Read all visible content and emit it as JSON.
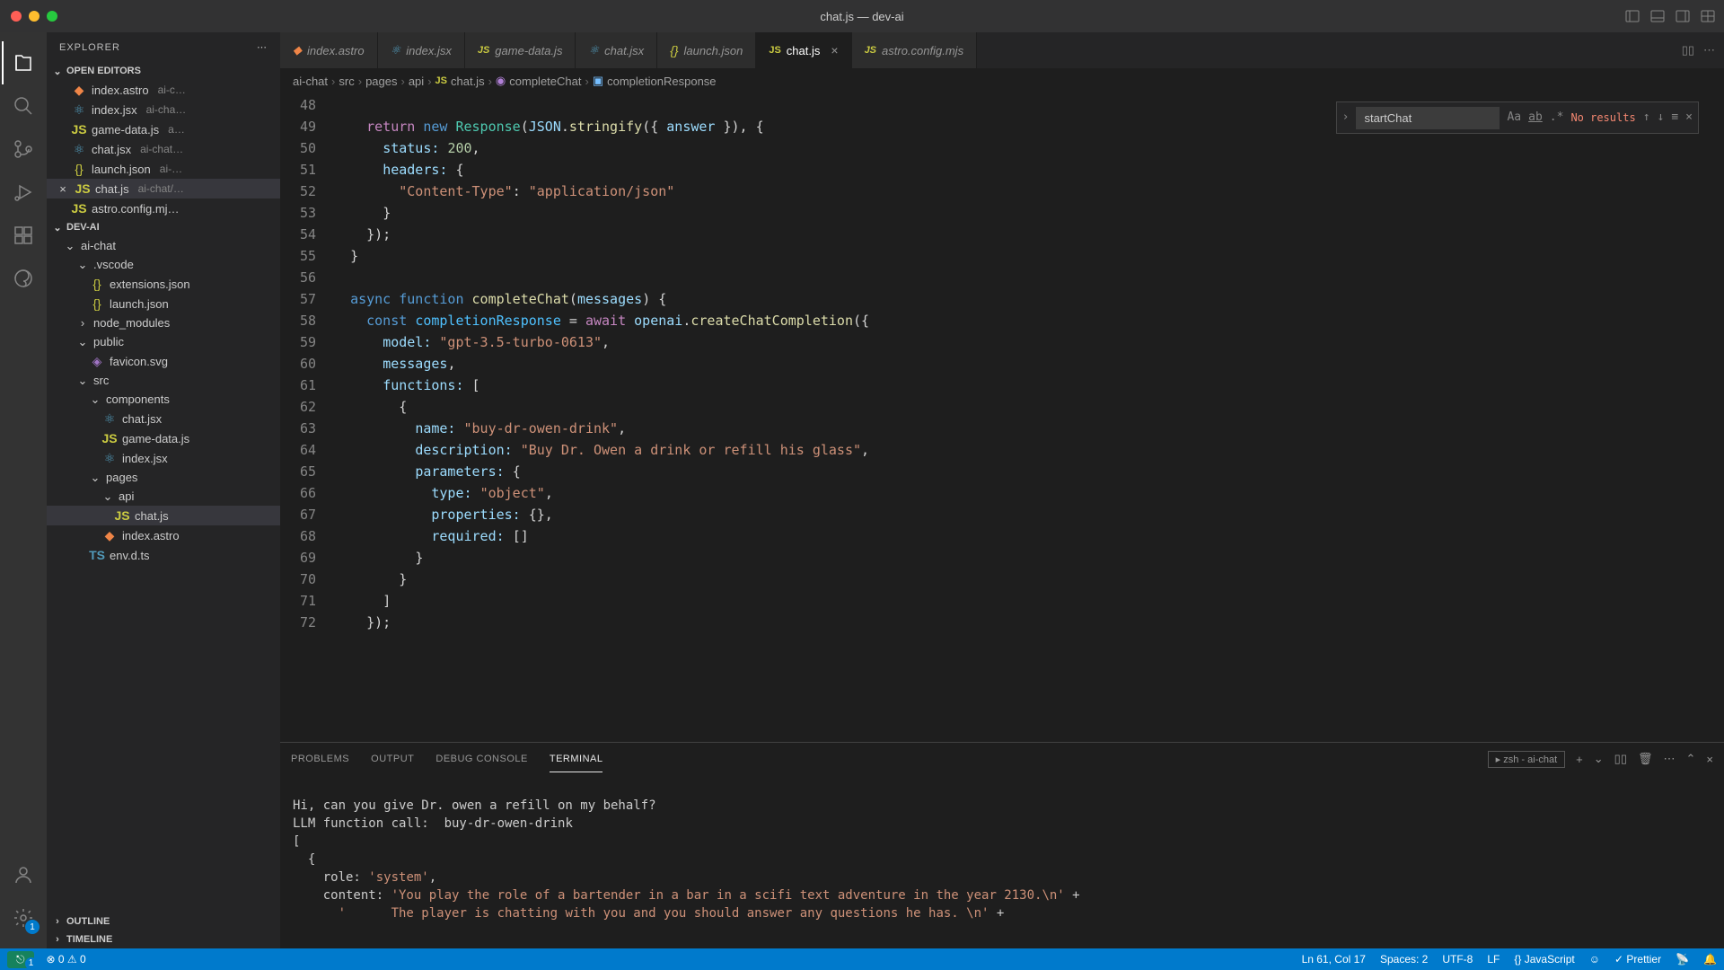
{
  "window": {
    "title": "chat.js — dev-ai"
  },
  "sidebar": {
    "header": "EXPLORER",
    "sections": {
      "open_editors": "OPEN EDITORS",
      "project": "DEV-AI",
      "outline": "OUTLINE",
      "timeline": "TIMELINE"
    },
    "open_editors": [
      {
        "name": "index.astro",
        "path": "ai-c…",
        "icon": "astro"
      },
      {
        "name": "index.jsx",
        "path": "ai-cha…",
        "icon": "jsx"
      },
      {
        "name": "game-data.js",
        "path": "a…",
        "icon": "js"
      },
      {
        "name": "chat.jsx",
        "path": "ai-chat…",
        "icon": "jsx"
      },
      {
        "name": "launch.json",
        "path": "ai-…",
        "icon": "json"
      },
      {
        "name": "chat.js",
        "path": "ai-chat/…",
        "icon": "js",
        "active": true
      },
      {
        "name": "astro.config.mj…",
        "path": "",
        "icon": "js"
      }
    ],
    "tree": {
      "root": "ai-chat",
      "vscode": ".vscode",
      "extensions": "extensions.json",
      "launch": "launch.json",
      "node_modules": "node_modules",
      "public": "public",
      "favicon": "favicon.svg",
      "src": "src",
      "components": "components",
      "chat_jsx": "chat.jsx",
      "game_data": "game-data.js",
      "index_jsx": "index.jsx",
      "pages": "pages",
      "api": "api",
      "chat_js": "chat.js",
      "index_astro": "index.astro",
      "env": "env.d.ts"
    }
  },
  "tabs": [
    {
      "label": "index.astro",
      "icon": "astro"
    },
    {
      "label": "index.jsx",
      "icon": "jsx"
    },
    {
      "label": "game-data.js",
      "icon": "js"
    },
    {
      "label": "chat.jsx",
      "icon": "jsx"
    },
    {
      "label": "launch.json",
      "icon": "json"
    },
    {
      "label": "chat.js",
      "icon": "js",
      "active": true
    },
    {
      "label": "astro.config.mjs",
      "icon": "js"
    }
  ],
  "breadcrumbs": [
    "ai-chat",
    "src",
    "pages",
    "api",
    "chat.js",
    "completeChat",
    "completionResponse"
  ],
  "find": {
    "value": "startChat",
    "results": "No results"
  },
  "code": {
    "lines": [
      48,
      49,
      50,
      51,
      52,
      53,
      54,
      55,
      56,
      57,
      58,
      59,
      60,
      61,
      62,
      63,
      64,
      65,
      66,
      67,
      68,
      69,
      70,
      71,
      72
    ],
    "l48": "",
    "l49_ret": "return",
    "l49_new": "new",
    "l49_resp": "Response",
    "l49_json": "JSON",
    "l49_strify": "stringify",
    "l49_ans": "answer",
    "l50_status": "status:",
    "l50_200": "200",
    "l51_headers": "headers:",
    "l52_ct": "\"Content-Type\"",
    "l52_val": "\"application/json\"",
    "l57_async": "async",
    "l57_fn": "function",
    "l57_name": "completeChat",
    "l57_param": "messages",
    "l58_const": "const",
    "l58_var": "completionResponse",
    "l58_await": "await",
    "l58_openai": "openai",
    "l58_method": "createChatCompletion",
    "l59_model": "model:",
    "l59_val": "\"gpt-3.5-turbo-0613\"",
    "l60_msgs": "messages",
    "l61_fns": "functions:",
    "l63_name": "name:",
    "l63_val": "\"buy-dr-owen-drink\"",
    "l64_desc": "description:",
    "l64_val": "\"Buy Dr. Owen a drink or refill his glass\"",
    "l65_params": "parameters:",
    "l66_type": "type:",
    "l66_val": "\"object\"",
    "l67_props": "properties:",
    "l68_req": "required:"
  },
  "panel": {
    "tabs": {
      "problems": "PROBLEMS",
      "output": "OUTPUT",
      "debug": "DEBUG CONSOLE",
      "terminal": "TERMINAL"
    },
    "shell": "zsh - ai-chat",
    "terminal": {
      "l1": "Hi, can you give Dr. owen a refill on my behalf?",
      "l2a": "LLM function call:  ",
      "l2b": "buy-dr-owen-drink",
      "l3": "[",
      "l4": "  {",
      "l5a": "    role: ",
      "l5b": "'system'",
      "l5c": ",",
      "l6a": "    content: ",
      "l6b": "'You play the role of a bartender in a bar in a scifi text adventure in the year 2130.\\n'",
      "l6c": " +",
      "l7a": "      ",
      "l7b": "'      The player is chatting with you and you should answer any questions he has. \\n'",
      "l7c": " +"
    }
  },
  "statusbar": {
    "errors": "0",
    "warnings": "0",
    "position": "Ln 61, Col 17",
    "spaces": "Spaces: 2",
    "encoding": "UTF-8",
    "eol": "LF",
    "language": "JavaScript",
    "prettier": "Prettier"
  }
}
